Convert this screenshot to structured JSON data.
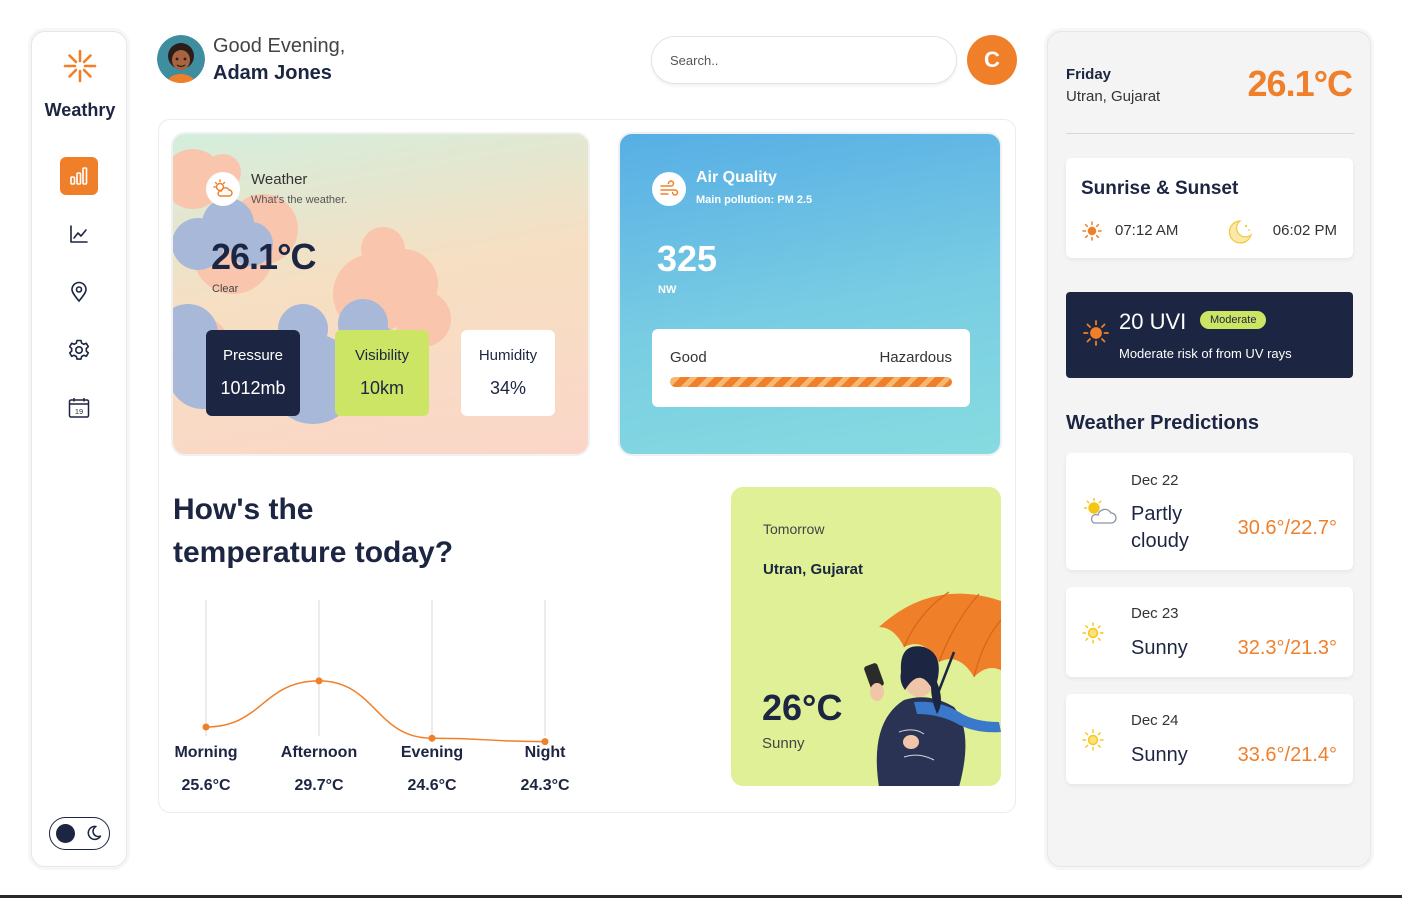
{
  "app": {
    "brand": "Weathry"
  },
  "nav": [
    {
      "name": "nav-dashboard",
      "icon": "bar-chart-icon",
      "active": true
    },
    {
      "name": "nav-analytics",
      "icon": "line-chart-icon",
      "active": false
    },
    {
      "name": "nav-location",
      "icon": "map-pin-icon",
      "active": false
    },
    {
      "name": "nav-settings",
      "icon": "gear-icon",
      "active": false
    },
    {
      "name": "nav-calendar",
      "icon": "calendar-icon",
      "active": false,
      "day": "19"
    }
  ],
  "theme_toggle": {
    "mode": "dark",
    "icon": "moon-icon"
  },
  "header": {
    "greeting": "Good Evening,",
    "user_name": "Adam Jones",
    "search_placeholder": "Search..",
    "profile_initial": "C"
  },
  "weather": {
    "title": "Weather",
    "subtitle": "What's the weather.",
    "temperature": "26.1°C",
    "condition": "Clear",
    "stats": {
      "pressure": {
        "label": "Pressure",
        "value": "1012mb"
      },
      "visibility": {
        "label": "Visibility",
        "value": "10km"
      },
      "humidity": {
        "label": "Humidity",
        "value": "34%"
      }
    }
  },
  "air_quality": {
    "title": "Air Quality",
    "subtitle": "Main pollution: PM 2.5",
    "value": "325",
    "direction": "NW",
    "scale_low": "Good",
    "scale_high": "Hazardous"
  },
  "temperature_today": {
    "title_line1": "How's the",
    "title_line2": "temperature today?"
  },
  "chart_data": {
    "type": "line",
    "categories": [
      "Morning",
      "Afternoon",
      "Evening",
      "Night"
    ],
    "values": [
      25.6,
      29.7,
      24.6,
      24.3
    ],
    "value_labels": [
      "25.6°C",
      "29.7°C",
      "24.6°C",
      "24.3°C"
    ],
    "color": "#f07f2a",
    "grid": "vertical"
  },
  "tomorrow": {
    "label": "Tomorrow",
    "location": "Utran, Gujarat",
    "temperature": "26°C",
    "condition": "Sunny"
  },
  "current": {
    "day": "Friday",
    "location": "Utran, Gujarat",
    "temperature": "26.1°C"
  },
  "sun": {
    "title": "Sunrise & Sunset",
    "sunrise": "07:12 AM",
    "sunset": "06:02 PM"
  },
  "uv": {
    "value": "20 UVI",
    "badge": "Moderate",
    "description": "Moderate risk of from UV rays"
  },
  "predictions": {
    "title": "Weather Predictions",
    "items": [
      {
        "date": "Dec 22",
        "condition_line1": "Partly",
        "condition_line2": "cloudy",
        "range": "30.6°/22.7°",
        "icon": "partly-cloudy-icon"
      },
      {
        "date": "Dec 23",
        "condition_line1": "Sunny",
        "range": "32.3°/21.3°",
        "icon": "sun-icon"
      },
      {
        "date": "Dec 24",
        "condition_line1": "Sunny",
        "range": "33.6°/21.4°",
        "icon": "sun-icon"
      }
    ]
  },
  "colors": {
    "accent": "#f07f2a",
    "navy": "#1c2541",
    "lime": "#cde565",
    "tomorrow_bg": "#dff097"
  }
}
